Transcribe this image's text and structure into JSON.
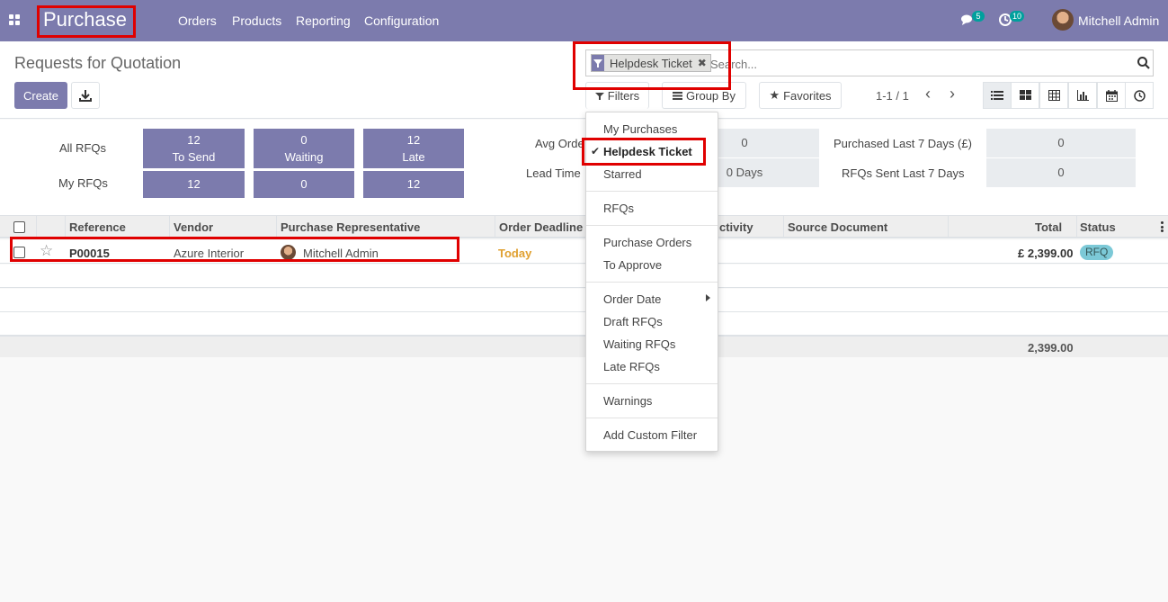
{
  "navbar": {
    "app_title": "Purchase",
    "menu": [
      "Orders",
      "Products",
      "Reporting",
      "Configuration"
    ],
    "messages_count": "5",
    "activities_count": "10",
    "user_name": "Mitchell Admin"
  },
  "control_panel": {
    "title": "Requests for Quotation",
    "create_label": "Create",
    "search": {
      "facet_label": "Helpdesk Ticket",
      "facet_remove": "✖",
      "placeholder": "Search..."
    },
    "filters_label": "Filters",
    "group_by_label": "Group By",
    "favorites_label": "Favorites",
    "pager": "1-1 / 1"
  },
  "dashboard": {
    "all_rfqs_label": "All RFQs",
    "my_rfqs_label": "My RFQs",
    "tiles": [
      {
        "value": "12",
        "label": "To Send"
      },
      {
        "value": "0",
        "label": "Waiting"
      },
      {
        "value": "12",
        "label": "Late"
      }
    ],
    "my_values": [
      "12",
      "0",
      "12"
    ],
    "avg_order_label": "Avg Orde",
    "avg_order_value": "0",
    "lead_time_label": "Lead Time",
    "lead_time_value": "0  Days",
    "purchased_label": "Purchased Last 7 Days (£)",
    "purchased_value": "0",
    "sent_label": "RFQs Sent Last 7 Days",
    "sent_value": "0"
  },
  "list": {
    "headers": {
      "reference": "Reference",
      "vendor": "Vendor",
      "representative": "Purchase Representative",
      "deadline": "Order Deadline",
      "activity": "ctivity",
      "source": "Source Document",
      "total": "Total",
      "status": "Status"
    },
    "rows": [
      {
        "reference": "P00015",
        "vendor": "Azure Interior",
        "representative": "Mitchell Admin",
        "deadline": "Today",
        "total": "£ 2,399.00",
        "status": "RFQ"
      }
    ],
    "footer_total": "2,399.00"
  },
  "filters_menu": {
    "items": [
      "My Purchases",
      "Helpdesk Ticket",
      "Starred",
      "RFQs",
      "Purchase Orders",
      "To Approve",
      "Order Date",
      "Draft RFQs",
      "Waiting RFQs",
      "Late RFQs",
      "Warnings",
      "Add Custom Filter"
    ]
  },
  "colors": {
    "brand": "#7c7bad",
    "badge": "#00a09d",
    "highlight": "#e00000",
    "deadline_today": "#e0a030",
    "rfq_badge": "#7cc9d7"
  }
}
